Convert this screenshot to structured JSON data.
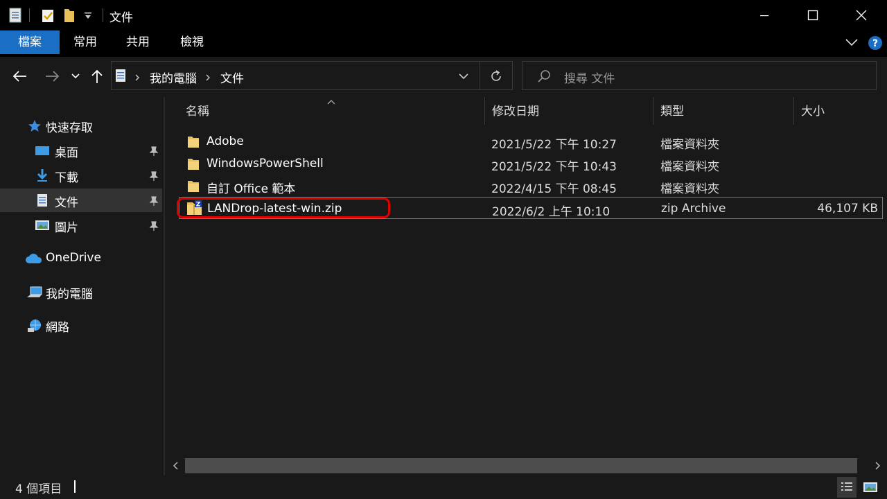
{
  "window": {
    "title": "文件"
  },
  "ribbon": {
    "tabs": [
      {
        "label": "檔案",
        "active": true
      },
      {
        "label": "常用",
        "active": false
      },
      {
        "label": "共用",
        "active": false
      },
      {
        "label": "檢視",
        "active": false
      }
    ]
  },
  "address": {
    "crumbs": [
      "我的電腦",
      "文件"
    ],
    "search_placeholder": "搜尋 文件"
  },
  "sidebar": {
    "items": [
      {
        "label": "快速存取",
        "icon": "star-icon"
      },
      {
        "label": "桌面",
        "icon": "desktop-icon",
        "pinned": true
      },
      {
        "label": "下載",
        "icon": "download-icon",
        "pinned": true
      },
      {
        "label": "文件",
        "icon": "document-icon",
        "pinned": true,
        "selected": true
      },
      {
        "label": "圖片",
        "icon": "picture-icon",
        "pinned": true
      },
      {
        "label": "OneDrive",
        "icon": "cloud-icon"
      },
      {
        "label": "我的電腦",
        "icon": "computer-icon"
      },
      {
        "label": "網路",
        "icon": "network-icon"
      }
    ]
  },
  "columns": {
    "name": "名稱",
    "modified": "修改日期",
    "type": "類型",
    "size": "大小"
  },
  "files": [
    {
      "name": "Adobe",
      "modified": "2021/5/22 下午 10:27",
      "type": "檔案資料夾",
      "size": "",
      "icon": "folder-icon"
    },
    {
      "name": "WindowsPowerShell",
      "modified": "2021/5/22 下午 10:43",
      "type": "檔案資料夾",
      "size": "",
      "icon": "folder-icon"
    },
    {
      "name": "自訂 Office 範本",
      "modified": "2022/4/15 下午 08:45",
      "type": "檔案資料夾",
      "size": "",
      "icon": "folder-icon"
    },
    {
      "name": "LANDrop-latest-win.zip",
      "modified": "2022/6/2 上午 10:10",
      "type": "zip Archive",
      "size": "46,107 KB",
      "icon": "zip-folder-icon",
      "selected": true
    }
  ],
  "status": {
    "count": "4 個項目"
  },
  "colors": {
    "accent": "#1a6fc4",
    "highlight": "#e00000",
    "folder": "#e8c15a"
  }
}
